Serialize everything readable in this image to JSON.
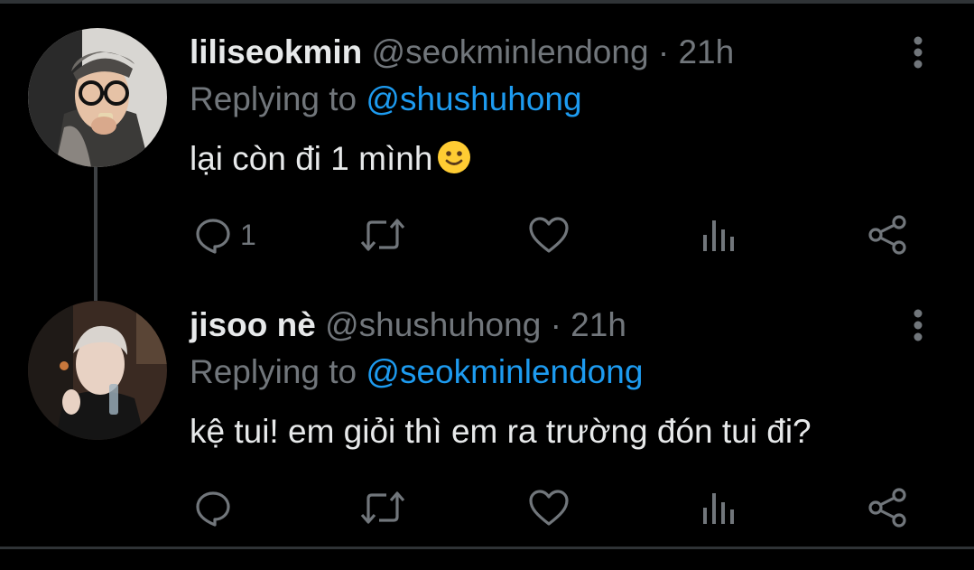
{
  "tweets": [
    {
      "display_name": "liliseokmin",
      "handle": "@seokminlendong",
      "separator": "·",
      "time": "21h",
      "replying_prefix": "Replying to",
      "replying_to": "@shushuhong",
      "text": "lại còn đi 1 mình",
      "emoji": "slightly-smiling-face",
      "reply_count": "1"
    },
    {
      "display_name": "jisoo nè",
      "handle": "@shushuhong",
      "separator": "·",
      "time": "21h",
      "replying_prefix": "Replying to",
      "replying_to": "@seokminlendong",
      "text": "kệ tui! em giỏi thì em ra trường đón tui đi?",
      "reply_count": ""
    }
  ],
  "colors": {
    "background": "#000000",
    "primary_text": "#e7e9ea",
    "secondary_text": "#71767b",
    "accent": "#1d9bf0",
    "divider": "#2f3336"
  }
}
